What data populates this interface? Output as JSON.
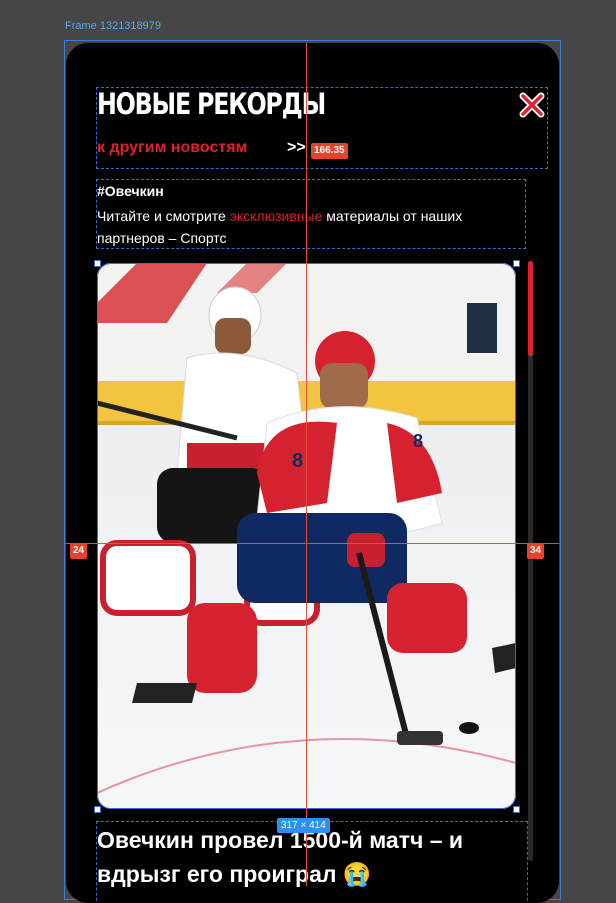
{
  "canvas": {
    "frame_label": "Frame 1321318979"
  },
  "header": {
    "title": "НОВЫЕ РЕКОРДЫ",
    "back_link": "к другим новостям",
    "back_arrows": ">>",
    "close_icon": "close-x-icon"
  },
  "info": {
    "tag": "#Овечкин",
    "desc_before": "Читайте и смотрите ",
    "desc_accent": "эксклюзивные",
    "desc_after": " материалы от наших партнеров – Спортс"
  },
  "media": {
    "image_description": "hockey-players-photo",
    "size_label": "317 × 414"
  },
  "article": {
    "headline": "Овечкин провел 1500-й матч – и вдрызг его проиграл 😭"
  },
  "measurements": {
    "top_value": "166.35",
    "left_value": "24",
    "right_value": "34"
  },
  "colors": {
    "accent": "#e0202e",
    "background": "#000000",
    "canvas": "#464646",
    "selection": "#3b6bd0"
  }
}
